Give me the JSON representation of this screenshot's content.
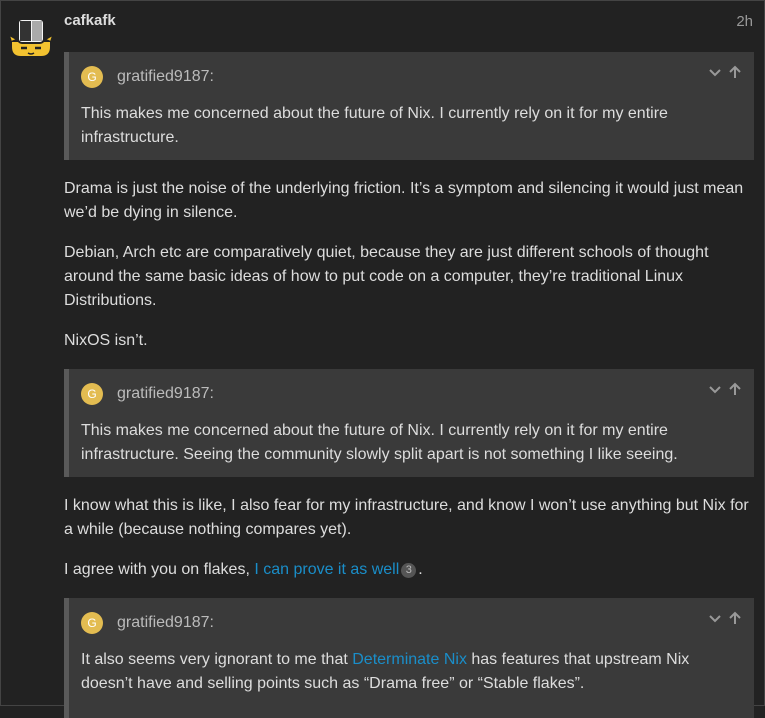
{
  "post": {
    "username": "cafkafk",
    "time": "2h"
  },
  "quotes": [
    {
      "avatar_letter": "G",
      "author": "gratified9187:",
      "text": "This makes me concerned about the future of Nix. I currently rely on it for my entire infrastructure."
    },
    {
      "avatar_letter": "G",
      "author": "gratified9187:",
      "text": "This makes me concerned about the future of Nix. I currently rely on it for my entire infrastructure. Seeing the community slowly split apart is not something I like seeing."
    },
    {
      "avatar_letter": "G",
      "author": "gratified9187:",
      "text_before_link": "It also seems very ignorant to me that ",
      "link_text": "Determinate Nix",
      "text_after_link": " has features that upstream Nix doesn’t have and selling points such as “Drama free” or “Stable flakes”."
    }
  ],
  "paragraphs": {
    "p1": "Drama is just the noise of the underlying friction. It’s a symptom and silencing it would just mean we’d be dying in silence.",
    "p2": "Debian, Arch etc are comparatively quiet, because they are just different schools of thought around the same basic ideas of how to put code on a computer, they’re traditional Linux Distributions.",
    "p3": "NixOS isn’t.",
    "p4": "I know what this is like, I also fear for my infrastructure, and know I won’t use anything but Nix for a while (because nothing compares yet).",
    "p5_before_link": "I agree with you on flakes, ",
    "p5_link": "I can prove it as well",
    "p5_badge": "3",
    "p5_after": "."
  },
  "icons": {
    "expand": "chevron-down-icon",
    "jump": "arrow-up-icon"
  },
  "colors": {
    "background": "#222222",
    "quote_background": "#3a3a3a",
    "link": "#1a8ec9",
    "quote_avatar": "#e3bc51"
  }
}
